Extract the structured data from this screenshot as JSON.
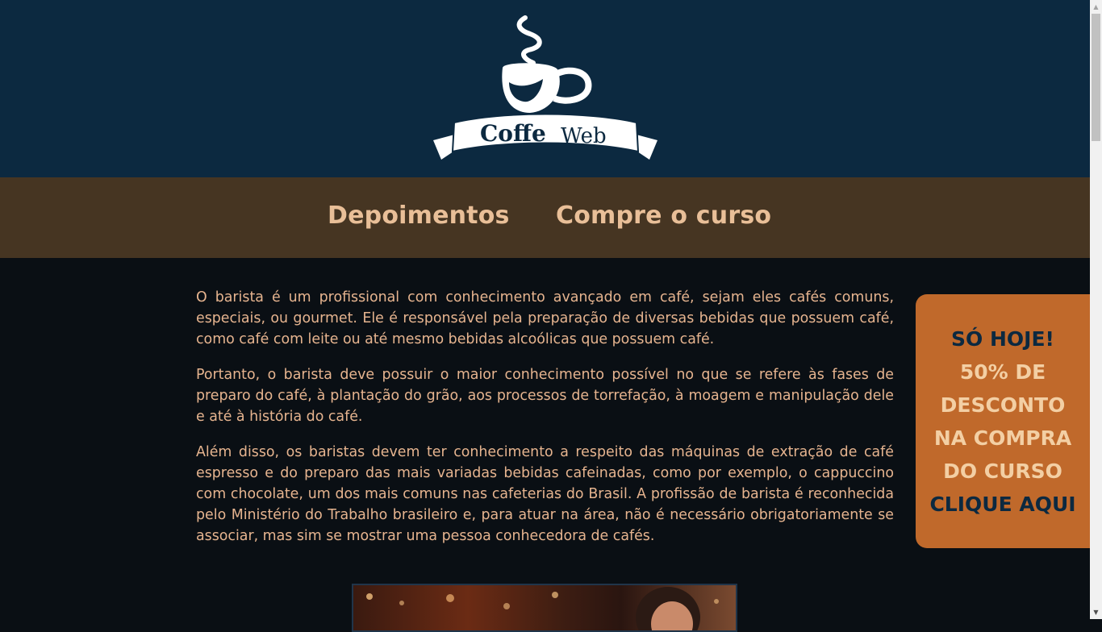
{
  "header": {
    "logo": {
      "word1": "Coffe",
      "word2": "Web",
      "icon": "coffee-cup-icon"
    }
  },
  "nav": {
    "links": [
      {
        "label": "Depoimentos"
      },
      {
        "label": "Compre o curso"
      }
    ]
  },
  "content": {
    "paragraphs": [
      "O barista é um profissional com conhecimento avançado em café, sejam eles cafés comuns, especiais, ou gourmet. Ele é responsável pela preparação de diversas bebidas que possuem café, como café com leite ou até mesmo bebidas alcoólicas que possuem café.",
      "Portanto, o barista deve possuir o maior conhecimento possível no que se refere às fases de preparo do café, à plantação do grão, aos processos de torrefação, à moagem e manipulação dele e até à história do café.",
      "Além disso, os baristas devem ter conhecimento a respeito das máquinas de extração de café espresso e do preparo das mais variadas bebidas cafeinadas, como por exemplo, o cappuccino com chocolate, um dos mais comuns nas cafeterias do Brasil. A profissão de barista é reconhecida pelo Ministério do Trabalho brasileiro e, para atuar na área, não é necessário obrigatoriamente se associar, mas sim se mostrar uma pessoa conhecedora de cafés."
    ]
  },
  "promo": {
    "line1": "SÓ HOJE!",
    "line2": "50% DE",
    "line3": "DESCONTO",
    "line4": "NA COMPRA",
    "line5": "DO CURSO",
    "line6": "CLIQUE AQUI"
  },
  "colors": {
    "header_bg": "#0c2940",
    "nav_bg": "#463522",
    "body_bg": "#0a0f14",
    "text": "#e6b48f",
    "promo_bg": "#c0692b"
  }
}
